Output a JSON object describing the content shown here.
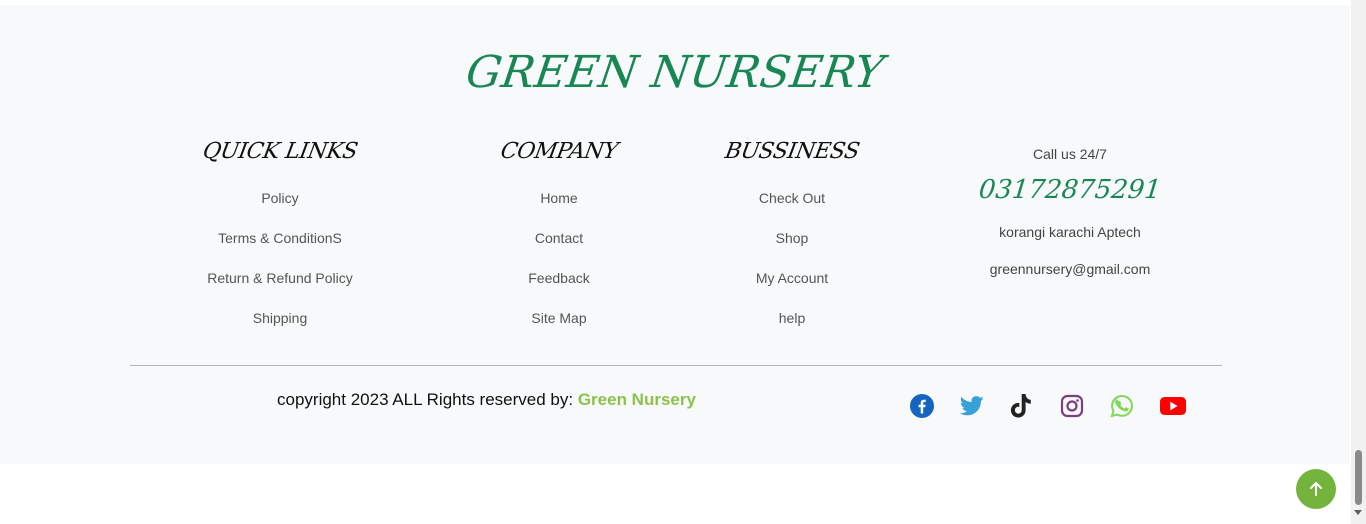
{
  "brand": {
    "name": "GREEN NURSERY"
  },
  "columns": [
    {
      "heading": "QUICK LINKS",
      "links": [
        "Policy",
        "Terms & ConditionS",
        "Return & Refund Policy",
        "Shipping"
      ]
    },
    {
      "heading": "COMPANY",
      "links": [
        "Home",
        "Contact",
        "Feedback",
        "Site Map"
      ]
    },
    {
      "heading": "BUSSINESS",
      "links": [
        "Check Out",
        "Shop",
        "My Account",
        "help"
      ]
    }
  ],
  "contact": {
    "call_label": "Call us 24/7",
    "phone": "03172875291",
    "address": "korangi karachi Aptech",
    "email": "greennursery@gmail.com"
  },
  "copyright": {
    "text": "copyright 2023 ALL Rights reserved by: ",
    "brand": "Green Nursery"
  },
  "social": [
    {
      "icon": "facebook-icon",
      "color": "#1565c0"
    },
    {
      "icon": "twitter-icon",
      "color": "#38a1d8"
    },
    {
      "icon": "tiktok-icon",
      "color": "#222222"
    },
    {
      "icon": "instagram-icon",
      "color": "#7b3f7e"
    },
    {
      "icon": "whatsapp-icon",
      "color": "#7ed957"
    },
    {
      "icon": "youtube-icon",
      "color": "#ff0000"
    }
  ],
  "colors": {
    "accent": "#198754",
    "light_green": "#8bc34a",
    "to_top": "#75b43c",
    "footer_bg": "#f8f9fa"
  },
  "to_top": {
    "icon": "arrow-up-icon"
  }
}
